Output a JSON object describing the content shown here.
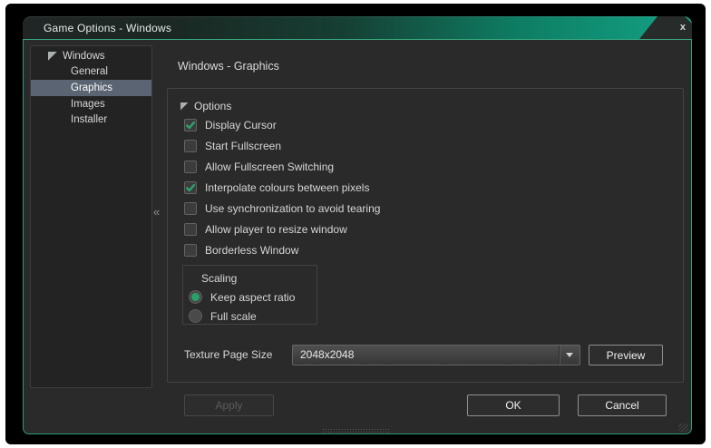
{
  "window": {
    "title": "Game Options - Windows",
    "close_glyph": "x"
  },
  "sidebar": {
    "root_label": "Windows",
    "collapse_glyph": "«",
    "items": [
      {
        "label": "General",
        "selected": false
      },
      {
        "label": "Graphics",
        "selected": true
      },
      {
        "label": "Images",
        "selected": false
      },
      {
        "label": "Installer",
        "selected": false
      }
    ]
  },
  "main": {
    "header": "Windows - Graphics",
    "options_group": {
      "label": "Options",
      "checkboxes": [
        {
          "label": "Display Cursor",
          "checked": true
        },
        {
          "label": "Start Fullscreen",
          "checked": false
        },
        {
          "label": "Allow Fullscreen Switching",
          "checked": false
        },
        {
          "label": "Interpolate colours between pixels",
          "checked": true
        },
        {
          "label": "Use synchronization to avoid tearing",
          "checked": false
        },
        {
          "label": "Allow player to resize window",
          "checked": false
        },
        {
          "label": "Borderless Window",
          "checked": false
        }
      ],
      "scaling_group": {
        "label": "Scaling",
        "radios": [
          {
            "label": "Keep aspect ratio",
            "selected": true
          },
          {
            "label": "Full scale",
            "selected": false
          }
        ]
      },
      "texture_page_size": {
        "label": "Texture Page Size",
        "value": "2048x2048",
        "preview_button": "Preview"
      }
    },
    "footer": {
      "apply": "Apply",
      "ok": "OK",
      "cancel": "Cancel"
    }
  },
  "colors": {
    "titlebar_teal": "#14a084",
    "dialog_border": "#2f9c74",
    "selection_slate": "#5a6472",
    "check_green": "#2fa26e",
    "radio_green": "#28a169",
    "body_background": "#2a2a2a"
  }
}
